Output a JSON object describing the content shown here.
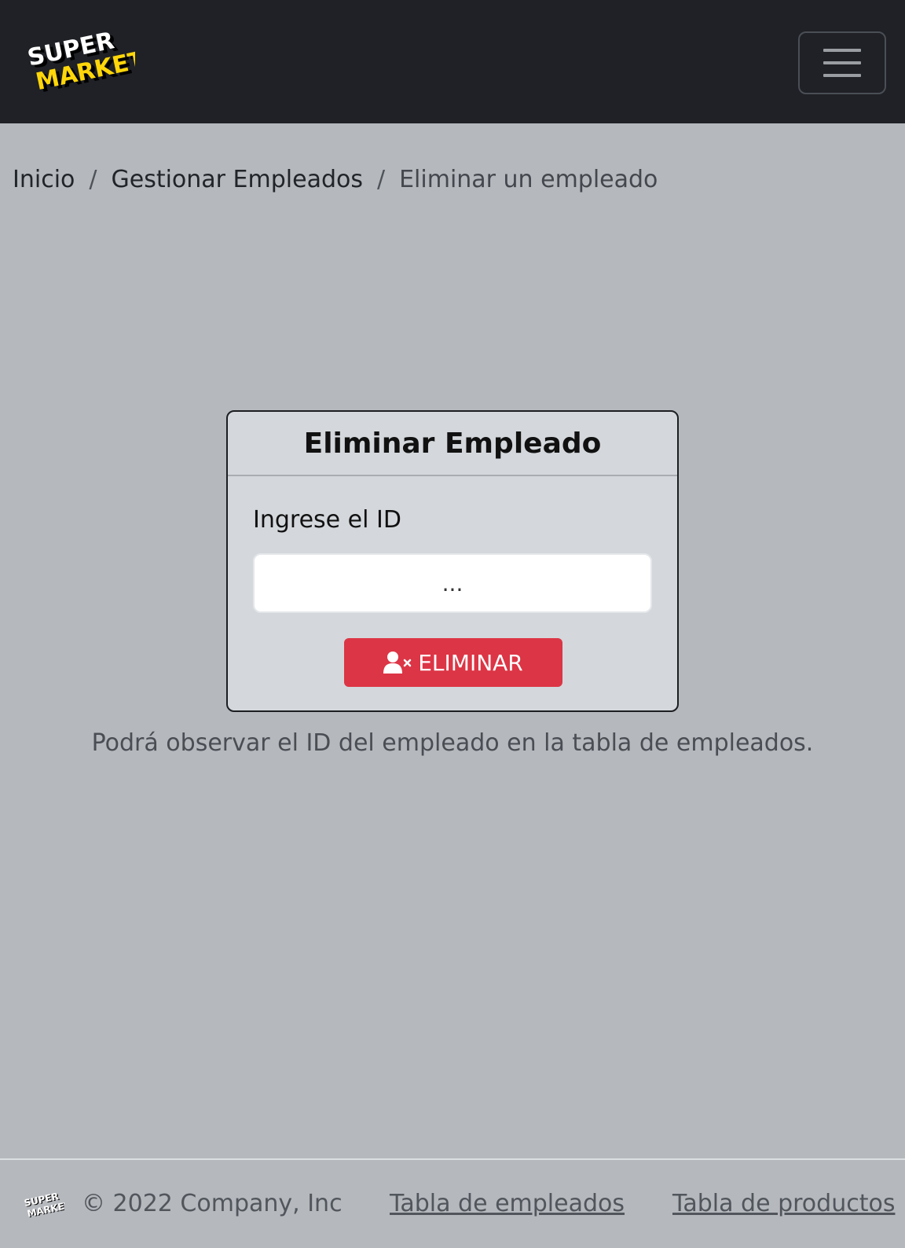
{
  "header": {
    "logo": {
      "line1": "SUPER",
      "line2": "MARKET"
    },
    "menu_icon": "hamburger-menu-icon"
  },
  "breadcrumb": {
    "home": "Inicio",
    "separator": "/",
    "manage": "Gestionar Empleados",
    "current": "Eliminar un empleado"
  },
  "card": {
    "title": "Eliminar Empleado",
    "id_label": "Ingrese el ID",
    "id_placeholder": "...",
    "id_value": "",
    "delete_label": "ELIMINAR",
    "delete_icon": "user-remove-icon"
  },
  "hint": "Podrá observar el ID del empleado en la tabla de empleados.",
  "footer": {
    "copyright": "© 2022 Company, Inc",
    "employees_link": "Tabla de empleados",
    "products_link": "Tabla de productos"
  },
  "colors": {
    "navbar": "#1f2126",
    "background": "#b5b8bd",
    "danger": "#dc3545",
    "logo_yellow": "#ffd60a"
  }
}
